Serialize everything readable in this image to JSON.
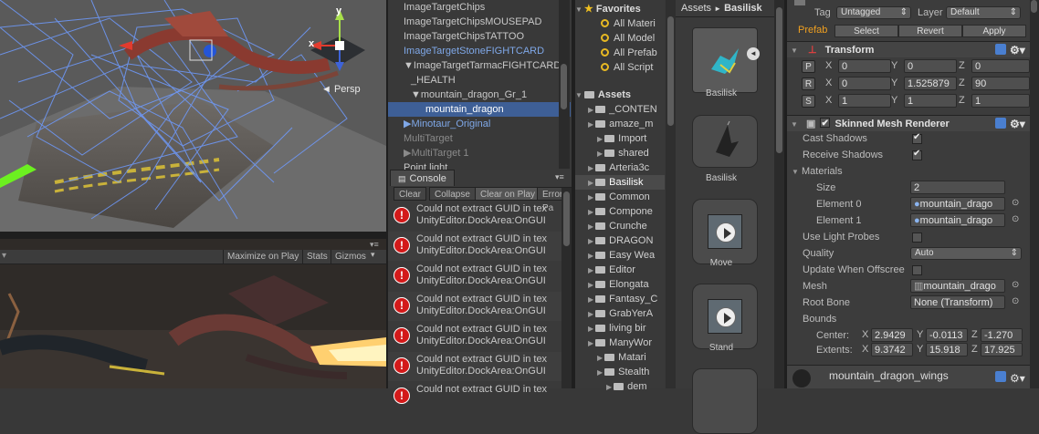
{
  "scene": {
    "persp_label": "◄ Persp",
    "axis_y": "y",
    "axis_x": "x"
  },
  "game": {
    "maximize_label": "Maximize on Play",
    "stats_label": "Stats",
    "gizmos_label": "Gizmos"
  },
  "hierarchy": {
    "items": [
      {
        "label": "ImageTargetChips",
        "indent": 0,
        "color": "#c8c8c8"
      },
      {
        "label": "ImageTargetChipsMOUSEPAD",
        "indent": 0,
        "color": "#c8c8c8"
      },
      {
        "label": "ImageTargetChipsTATTOO",
        "indent": 0,
        "color": "#c8c8c8"
      },
      {
        "label": "ImageTargetStoneFIGHTCARD",
        "indent": 0,
        "color": "#7fa8e8"
      },
      {
        "label": "▼ImageTargetTarmacFIGHTCARD",
        "indent": 0,
        "color": "#c8c8c8"
      },
      {
        "label": "_HEALTH",
        "indent": 1,
        "color": "#c8c8c8"
      },
      {
        "label": "▼mountain_dragon_Gr_1",
        "indent": 1,
        "color": "#c8c8c8"
      },
      {
        "label": "mountain_dragon",
        "indent": 3,
        "color": "#ffffff",
        "selected": true
      },
      {
        "label": "▶Minotaur_Original",
        "indent": 0,
        "color": "#7fa8e8"
      },
      {
        "label": "MultiTarget",
        "indent": 0,
        "color": "#8a8a8a"
      },
      {
        "label": "▶MultiTarget 1",
        "indent": 0,
        "color": "#8a8a8a"
      },
      {
        "label": "Point light",
        "indent": 0,
        "color": "#c8c8c8"
      }
    ]
  },
  "console": {
    "tab": "Console",
    "buttons": [
      "Clear",
      "Collapse",
      "Clear on Play",
      "Error Pa"
    ],
    "messages": [
      {
        "line1": "Could not extract GUID in tex",
        "line2": "UnityEditor.DockArea:OnGUI"
      },
      {
        "line1": "Could not extract GUID in tex",
        "line2": "UnityEditor.DockArea:OnGUI"
      },
      {
        "line1": "Could not extract GUID in tex",
        "line2": "UnityEditor.DockArea:OnGUI"
      },
      {
        "line1": "Could not extract GUID in tex",
        "line2": "UnityEditor.DockArea:OnGUI"
      },
      {
        "line1": "Could not extract GUID in tex",
        "line2": "UnityEditor.DockArea:OnGUI"
      },
      {
        "line1": "Could not extract GUID in tex",
        "line2": "UnityEditor.DockArea:OnGUI"
      },
      {
        "line1": "Could not extract GUID in tex",
        "line2": ""
      }
    ]
  },
  "project": {
    "favorites_label": "Favorites",
    "favorites": [
      "All Materi",
      "All Model",
      "All Prefab",
      "All Script"
    ],
    "assets_label": "Assets",
    "folders": [
      {
        "label": "_CONTEN",
        "indent": 1
      },
      {
        "label": "amaze_m",
        "indent": 1
      },
      {
        "label": "Import",
        "indent": 2
      },
      {
        "label": "shared",
        "indent": 2
      },
      {
        "label": "Arteria3c",
        "indent": 1
      },
      {
        "label": "Basilisk",
        "indent": 1,
        "selected": true
      },
      {
        "label": "Common",
        "indent": 1
      },
      {
        "label": "Compone",
        "indent": 1
      },
      {
        "label": "Crunche",
        "indent": 1
      },
      {
        "label": "DRAGON",
        "indent": 1
      },
      {
        "label": "Easy Wea",
        "indent": 1
      },
      {
        "label": "Editor",
        "indent": 1
      },
      {
        "label": "Elongata",
        "indent": 1
      },
      {
        "label": "Fantasy_C",
        "indent": 1
      },
      {
        "label": "GrabYerA",
        "indent": 1
      },
      {
        "label": "living bir",
        "indent": 1
      },
      {
        "label": "ManyWor",
        "indent": 1
      },
      {
        "label": "Matari",
        "indent": 2
      },
      {
        "label": "Stealth",
        "indent": 2
      },
      {
        "label": "dem",
        "indent": 3
      }
    ]
  },
  "assets": {
    "breadcrumb_root": "Assets",
    "breadcrumb_arrow": "►",
    "breadcrumb_current": "Basilisk",
    "items": [
      {
        "label": "Basilisk",
        "kind": "model"
      },
      {
        "label": "Basilisk",
        "kind": "prefab"
      },
      {
        "label": "Move",
        "kind": "anim"
      },
      {
        "label": "Stand",
        "kind": "anim"
      }
    ]
  },
  "inspector": {
    "tag_label": "Tag",
    "tag_value": "Untagged",
    "layer_label": "Layer",
    "layer_value": "Default",
    "prefab_label": "Prefab",
    "select_label": "Select",
    "revert_label": "Revert",
    "apply_label": "Apply",
    "transform_title": "Transform",
    "position": {
      "btn": "P",
      "x": "0",
      "y": "0",
      "z": "0"
    },
    "rotation": {
      "btn": "R",
      "x": "0",
      "y": "1.525879",
      "z": "90"
    },
    "scale": {
      "btn": "S",
      "x": "1",
      "y": "1",
      "z": "1"
    },
    "smr_title": "Skinned Mesh Renderer",
    "cast_shadows": "Cast Shadows",
    "receive_shadows": "Receive Shadows",
    "materials": "Materials",
    "size_label": "Size",
    "size_value": "2",
    "element0_label": "Element 0",
    "element0_value": "mountain_drago",
    "element1_label": "Element 1",
    "element1_value": "mountain_drago",
    "light_probes": "Use Light Probes",
    "quality_label": "Quality",
    "quality_value": "Auto",
    "update_offscreen": "Update When Offscree",
    "mesh_label": "Mesh",
    "mesh_value": "mountain_drago",
    "root_bone_label": "Root Bone",
    "root_bone_value": "None (Transform)",
    "bounds_label": "Bounds",
    "center_label": "Center:",
    "center": {
      "x": "2.9429",
      "y": "-0.0113",
      "z": "-1.270"
    },
    "extents_label": "Extents:",
    "extents": {
      "x": "9.3742",
      "y": "15.918",
      "z": "17.925"
    },
    "wings_label": "mountain_dragon_wings"
  },
  "colors": {
    "selection": "#3e5f96",
    "error": "#d31a1a",
    "accent_blue": "#7fa8e8",
    "prefab_orange": "#f0a020"
  }
}
